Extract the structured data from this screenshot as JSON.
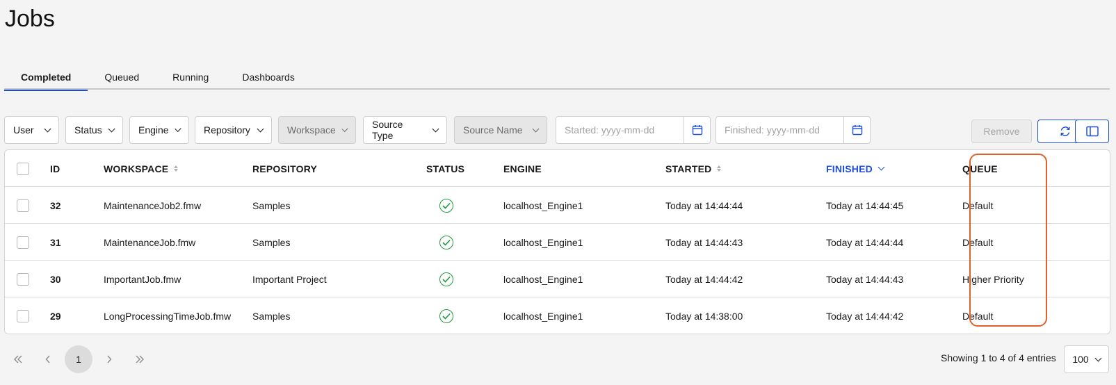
{
  "page": {
    "title": "Jobs"
  },
  "tabs": [
    {
      "label": "Completed",
      "active": true
    },
    {
      "label": "Queued",
      "active": false
    },
    {
      "label": "Running",
      "active": false
    },
    {
      "label": "Dashboards",
      "active": false
    }
  ],
  "filters": {
    "user": "User",
    "status": "Status",
    "engine": "Engine",
    "repository": "Repository",
    "workspace": "Workspace",
    "source_type": "Source Type",
    "source_name": "Source Name",
    "started_placeholder": "Started: yyyy-mm-dd",
    "finished_placeholder": "Finished: yyyy-mm-dd"
  },
  "actions": {
    "remove": "Remove",
    "refresh_icon": "refresh-icon",
    "columns_icon": "columns-icon"
  },
  "table": {
    "headers": {
      "id": "ID",
      "workspace": "WORKSPACE",
      "repository": "REPOSITORY",
      "status": "STATUS",
      "engine": "ENGINE",
      "started": "STARTED",
      "finished": "FINISHED",
      "queue": "QUEUE"
    },
    "rows": [
      {
        "id": "32",
        "workspace": "MaintenanceJob2.fmw",
        "repository": "Samples",
        "status": "success",
        "engine": "localhost_Engine1",
        "started": "Today at 14:44:44",
        "finished": "Today at 14:44:45",
        "queue": "Default"
      },
      {
        "id": "31",
        "workspace": "MaintenanceJob.fmw",
        "repository": "Samples",
        "status": "success",
        "engine": "localhost_Engine1",
        "started": "Today at 14:44:43",
        "finished": "Today at 14:44:44",
        "queue": "Default"
      },
      {
        "id": "30",
        "workspace": "ImportantJob.fmw",
        "repository": "Important Project",
        "status": "success",
        "engine": "localhost_Engine1",
        "started": "Today at 14:44:42",
        "finished": "Today at 14:44:43",
        "queue": "Higher Priority"
      },
      {
        "id": "29",
        "workspace": "LongProcessingTimeJob.fmw",
        "repository": "Samples",
        "status": "success",
        "engine": "localhost_Engine1",
        "started": "Today at 14:38:00",
        "finished": "Today at 14:44:42",
        "queue": "Default"
      }
    ]
  },
  "pagination": {
    "current_page": "1",
    "summary": "Showing 1 to 4 of 4 entries",
    "page_size": "100"
  },
  "colors": {
    "accent": "#1d4ed8",
    "success": "#1e9a3c",
    "highlight": "#e0622a"
  }
}
